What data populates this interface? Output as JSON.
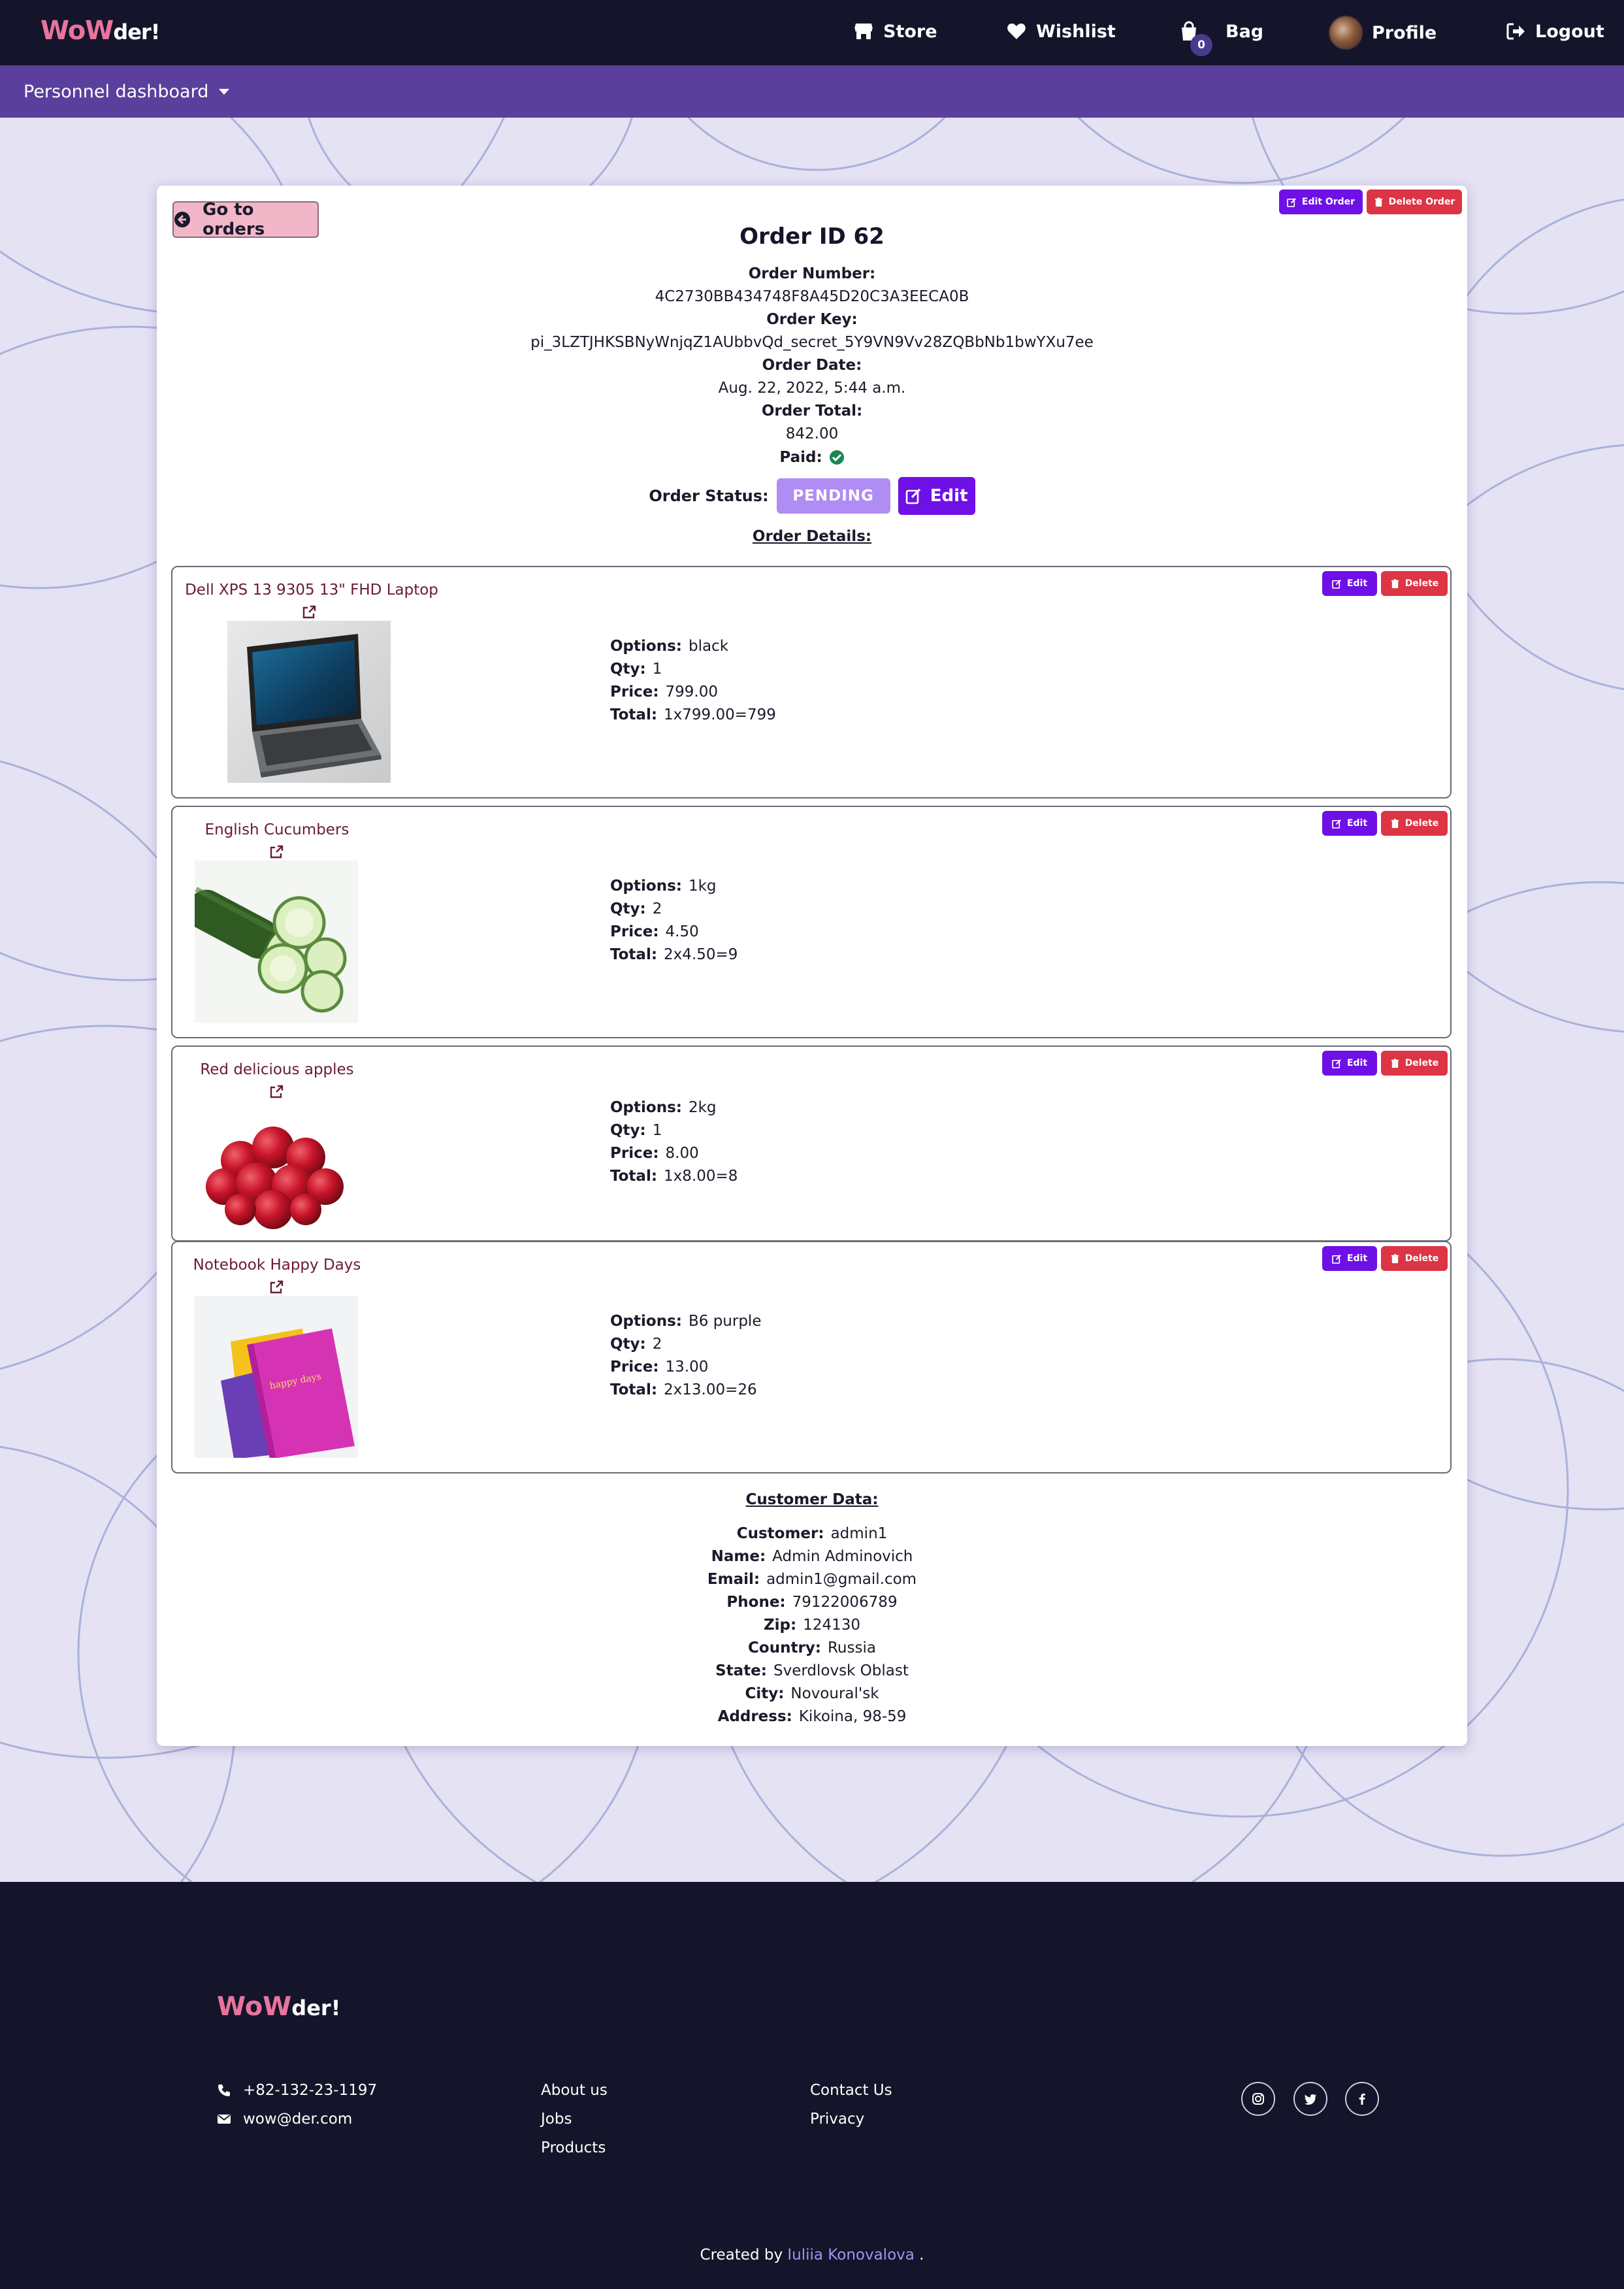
{
  "brand": {
    "first": "WoW",
    "second": "der!"
  },
  "nav": {
    "store": "Store",
    "wishlist": "Wishlist",
    "bag": "Bag",
    "bag_count": "0",
    "profile": "Profile",
    "logout": "Logout"
  },
  "subnav": {
    "dashboard_label": "Personnel dashboard"
  },
  "order": {
    "back_label": "Go to orders",
    "edit_order_label": "Edit Order",
    "delete_order_label": "Delete Order",
    "title": "Order ID 62",
    "number_label": "Order Number:",
    "number": "4C2730BB434748F8A45D20C3A3EECA0B",
    "key_label": "Order Key:",
    "key": "pi_3LZTJHKSBNyWnjqZ1AUbbvQd_secret_5Y9VN9Vv28ZQBbNb1bwYXu7ee",
    "date_label": "Order Date:",
    "date": "Aug. 22, 2022, 5:44 a.m.",
    "total_label": "Order Total:",
    "total": "842.00",
    "paid_label": "Paid:",
    "paid": true,
    "status_label": "Order Status:",
    "status": "PENDING",
    "status_edit_label": "Edit",
    "details_heading": "Order Details:"
  },
  "item_labels": {
    "edit": "Edit",
    "delete": "Delete",
    "options": "Options:",
    "qty": "Qty:",
    "price": "Price:",
    "total": "Total:"
  },
  "items": [
    {
      "name": "Dell XPS 13 9305 13\" FHD Laptop",
      "options": "black",
      "qty": "1",
      "price": "799.00",
      "total": "1x799.00=799"
    },
    {
      "name": "English Cucumbers",
      "options": "1kg",
      "qty": "2",
      "price": "4.50",
      "total": "2x4.50=9"
    },
    {
      "name": "Red delicious apples",
      "options": "2kg",
      "qty": "1",
      "price": "8.00",
      "total": "1x8.00=8"
    },
    {
      "name": "Notebook Happy Days",
      "options": "B6 purple",
      "qty": "2",
      "price": "13.00",
      "total": "2x13.00=26"
    }
  ],
  "notebook_cover_text": "happy days",
  "customer": {
    "heading": "Customer Data:",
    "fields": [
      {
        "label": "Customer:",
        "value": "admin1"
      },
      {
        "label": "Name:",
        "value": "Admin Adminovich"
      },
      {
        "label": "Email:",
        "value": "admin1@gmail.com"
      },
      {
        "label": "Phone:",
        "value": "79122006789"
      },
      {
        "label": "Zip:",
        "value": "124130"
      },
      {
        "label": "Country:",
        "value": "Russia"
      },
      {
        "label": "State:",
        "value": "Sverdlovsk Oblast"
      },
      {
        "label": "City:",
        "value": "Novoural'sk"
      },
      {
        "label": "Address:",
        "value": "Kikoina, 98-59"
      }
    ]
  },
  "footer": {
    "phone": "+82-132-23-1197",
    "email": "wow@der.com",
    "links_col1": [
      "About us",
      "Jobs",
      "Products"
    ],
    "links_col2": [
      "Contact Us",
      "Privacy"
    ],
    "social": [
      "instagram-icon",
      "twitter-icon",
      "facebook-icon"
    ],
    "credit_prefix": "Created by",
    "credit_author": "Iuliia Konovalova",
    "credit_suffix": "."
  },
  "colors": {
    "navbar": "#14142a",
    "subbar": "#5a3f9c",
    "page_bg": "#e5e2f4",
    "accent_violet": "#6f10e6",
    "danger_red": "#dc3545",
    "brand_pink": "#e8749c",
    "pending": "#b08cf5",
    "back_button": "#f1b7c9"
  }
}
